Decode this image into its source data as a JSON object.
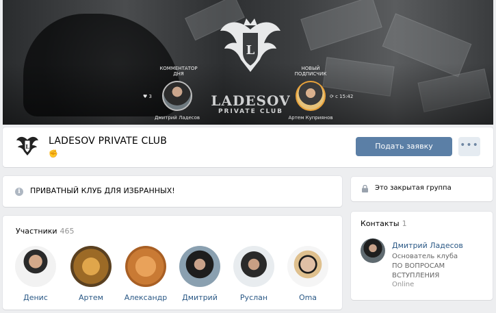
{
  "cover": {
    "left_caption_line1": "КОММЕНТАТОР",
    "left_caption_line2": "ДНЯ",
    "left_name": "Дмитрий Ладесов",
    "left_stat": "♥ 3",
    "right_caption_line1": "НОВЫЙ",
    "right_caption_line2": "ПОДПИСЧИК",
    "right_name": "Артем Куприянов",
    "right_stat": "⟳ с 15:42",
    "logo_line1": "LADESOV",
    "logo_line2": "PRIVATE CLUB"
  },
  "header": {
    "title": "LADESOV PRIVATE CLUB",
    "emoji": "✊",
    "join_label": "Подать заявку",
    "more_label": "•••"
  },
  "status": {
    "icon": "info-icon",
    "text": "ПРИВАТНЫЙ КЛУБ ДЛЯ ИЗБРАННЫХ!"
  },
  "members": {
    "label": "Участники",
    "count": "465",
    "items": [
      {
        "name": "Денис"
      },
      {
        "name": "Артем"
      },
      {
        "name": "Александр"
      },
      {
        "name": "Дмитрий"
      },
      {
        "name": "Руслан"
      },
      {
        "name": "Oma"
      }
    ]
  },
  "closed": {
    "icon": "lock-icon",
    "text": "Это закрытая группа"
  },
  "contacts": {
    "label": "Контакты",
    "count": "1",
    "name": "Дмитрий Ладесов",
    "role_line1": "Основатель клуба",
    "role_line2": "ПО ВОПРОСАМ",
    "role_line3": "ВСТУПЛЕНИЯ",
    "online": "Online"
  },
  "colors": {
    "accent": "#5b7fa6",
    "link": "#2a5885",
    "page_bg": "#edeef0"
  }
}
